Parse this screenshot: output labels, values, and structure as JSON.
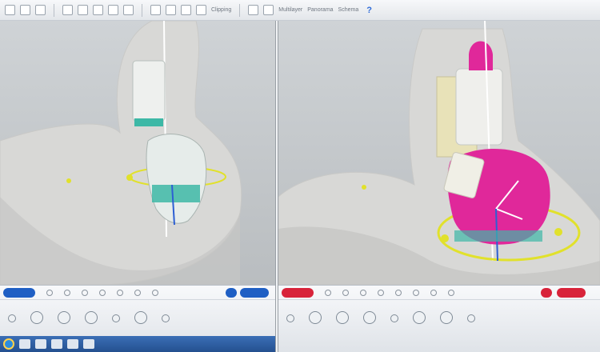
{
  "toolbar": {
    "label_a": "Clipping",
    "label_b": "Multilayer",
    "label_c": "Panorama",
    "label_d": "Schema",
    "help_label": "?"
  },
  "views": {
    "left": {
      "label": "left 3D viewport"
    },
    "right": {
      "label": "right 3D viewport"
    }
  },
  "colors": {
    "accent_blue": "#1f5fc4",
    "accent_red": "#d8233a",
    "implant_magenta": "#e0289a",
    "implant_teal": "#3db8a6",
    "guide_yellow": "#e1e12b"
  }
}
